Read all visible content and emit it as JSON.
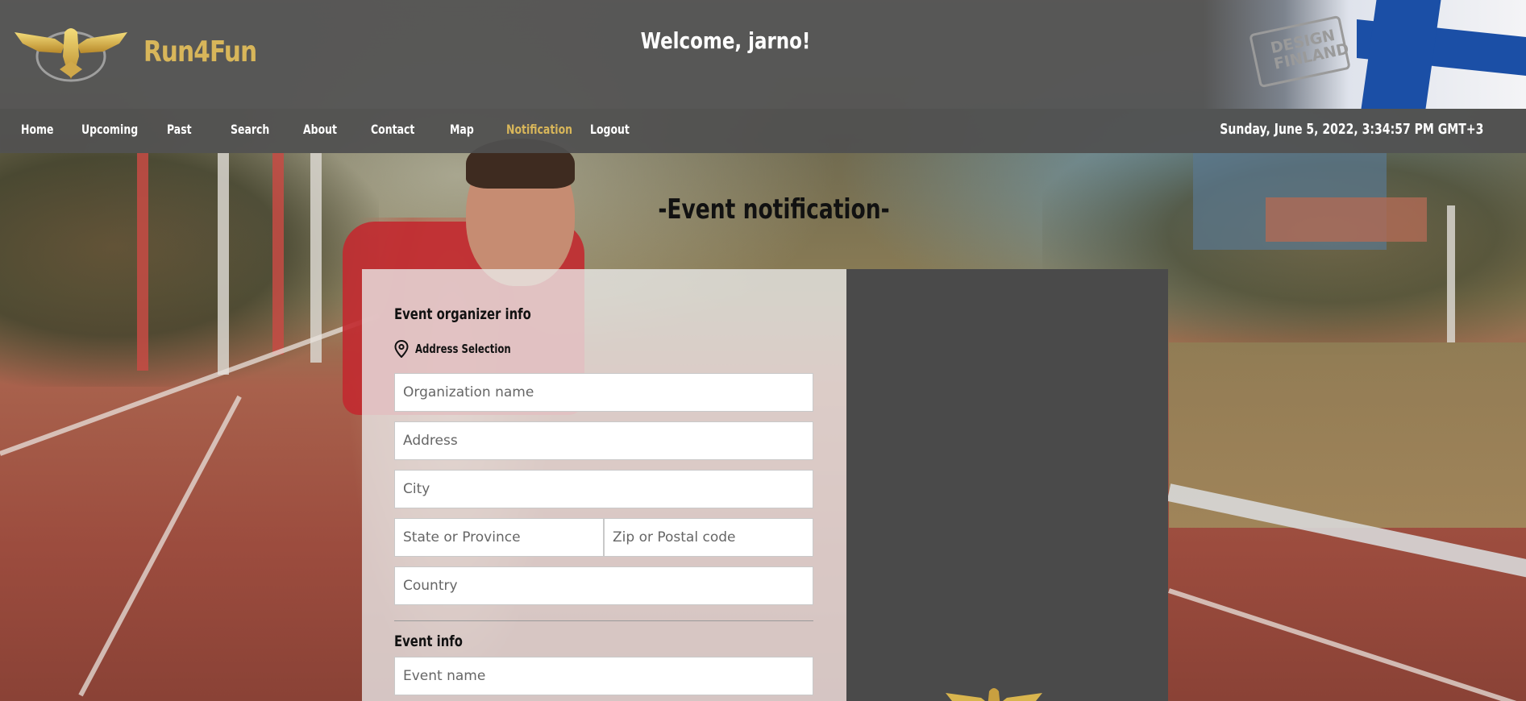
{
  "header": {
    "brand": "Run4Fun",
    "welcome": "Welcome, jarno!",
    "badge_line1": "DESIGN",
    "badge_line2": "FINLAND"
  },
  "nav": {
    "items": [
      {
        "label": "Home"
      },
      {
        "label": "Upcoming"
      },
      {
        "label": "Past"
      },
      {
        "label": "Search"
      },
      {
        "label": "About"
      },
      {
        "label": "Contact"
      },
      {
        "label": "Map"
      },
      {
        "label": "Notification",
        "active": true
      },
      {
        "label": "Logout"
      }
    ],
    "datetime": "Sunday, June 5, 2022, 3:34:57 PM GMT+3"
  },
  "page": {
    "title": "-Event notification-"
  },
  "form": {
    "organizer_heading": "Event organizer info",
    "address_selection": "Address Selection",
    "organization_placeholder": "Organization name",
    "address_placeholder": "Address",
    "city_placeholder": "City",
    "state_placeholder": "State or Province",
    "zip_placeholder": "Zip or Postal code",
    "country_placeholder": "Country",
    "event_heading": "Event info",
    "event_name_placeholder": "Event name"
  },
  "colors": {
    "accent_gold": "#d8b65a",
    "header_bg": "#555555",
    "panel_dark": "#4a4a4a"
  },
  "icons": [
    "eagle-logo-icon",
    "map-pin-icon",
    "finland-flag-icon"
  ]
}
